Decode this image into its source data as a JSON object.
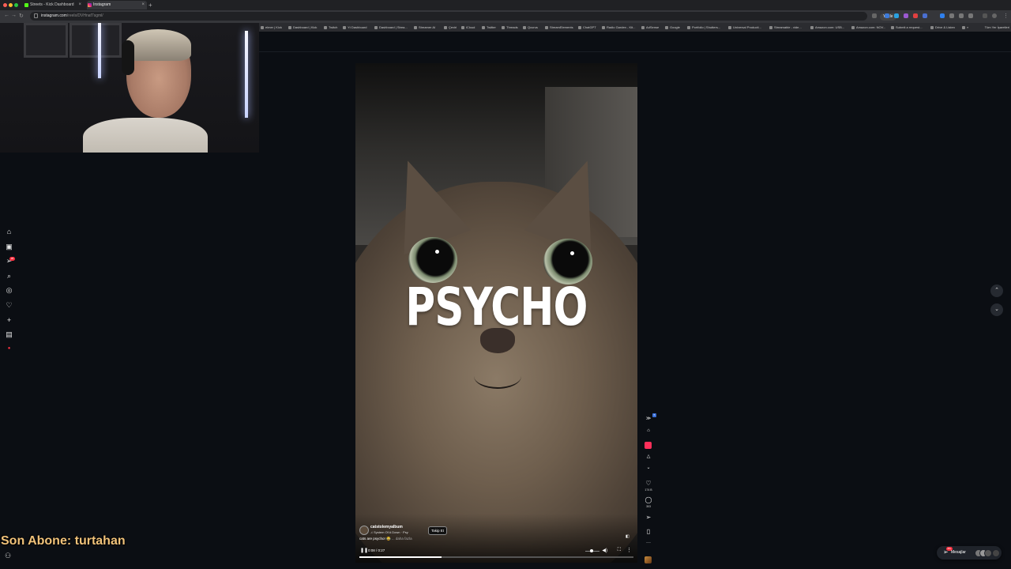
{
  "browser": {
    "tabs": [
      {
        "label": "Streets - Kick Dashboard",
        "active": false
      },
      {
        "label": "Instagram",
        "active": true
      }
    ],
    "url_host": "instagram.com",
    "url_path": "/reels/DVHnaf7sgml/",
    "install_label": "Yükle",
    "bookmarks": [
      "elmer | Kick",
      "Dashboard | Kick",
      "Twitch",
      "Yt Dashboard",
      "Dashboard | Strea...",
      "Streamer AI",
      "Çeviri",
      "iCloud",
      "Twitter",
      "Threads",
      "Qcurus",
      "StreamElements",
      "ChatGPT",
      "Radio Garden - Kit...",
      "AdSense",
      "Google",
      "Portfolio | Shutters...",
      "Universal Producti...",
      "Streamable - vide...",
      "Amazon.com: USB...",
      "Amazon.com: NOV...",
      "Submit a request...",
      "Drive & Listen"
    ],
    "bookmarks_more": "»",
    "bookmarks_right": "Tüm Yer İşaretleri"
  },
  "reel": {
    "overlay_text": "PSYCHO",
    "author": "catstolemyalbum",
    "music": "System Of A Down · Psy",
    "follow_label": "Takip Et",
    "caption": "cats are psycho! 😂",
    "caption_more": "... daha fazla",
    "time": "0:08 / 0:27",
    "progress": 0.3
  },
  "side_actions": {
    "likes": "174 B",
    "comments": "303",
    "badge": "5"
  },
  "messages": {
    "label": "Mesajlar",
    "badge": "20+"
  },
  "left_nav_badge": "20",
  "stream_overlay": {
    "last_sub": "Son Abone: turtahan"
  }
}
